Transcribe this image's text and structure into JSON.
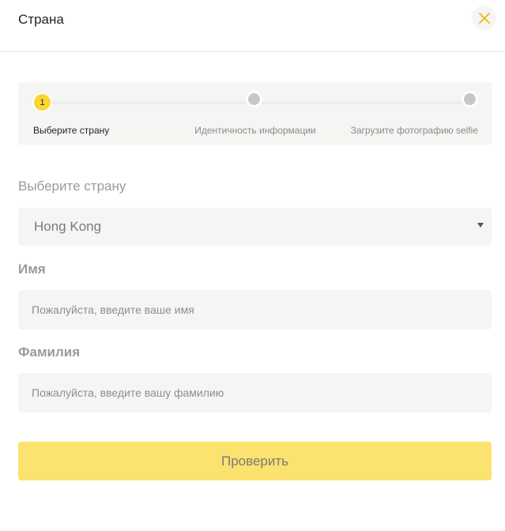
{
  "header": {
    "title": "Страна",
    "close_icon": "close-icon",
    "accent_color": "#f0b90b"
  },
  "stepper": {
    "steps": [
      {
        "number": "1",
        "label": "Выберите страну",
        "state": "active"
      },
      {
        "number": "",
        "label": "Идентичность информации",
        "state": "inactive"
      },
      {
        "number": "",
        "label": "Загрузите фотографию selfie",
        "state": "inactive"
      }
    ],
    "active_color": "#fcd535"
  },
  "form": {
    "country": {
      "label": "Выберите страну",
      "value": "Hong Kong"
    },
    "first_name": {
      "label": "Имя",
      "value": "",
      "placeholder": "Пожалуйста, введите ваше имя"
    },
    "last_name": {
      "label": "Фамилия",
      "value": "",
      "placeholder": "Пожалуйста, введите вашу фамилию"
    },
    "submit_label": "Проверить",
    "submit_color": "#fce36f"
  }
}
